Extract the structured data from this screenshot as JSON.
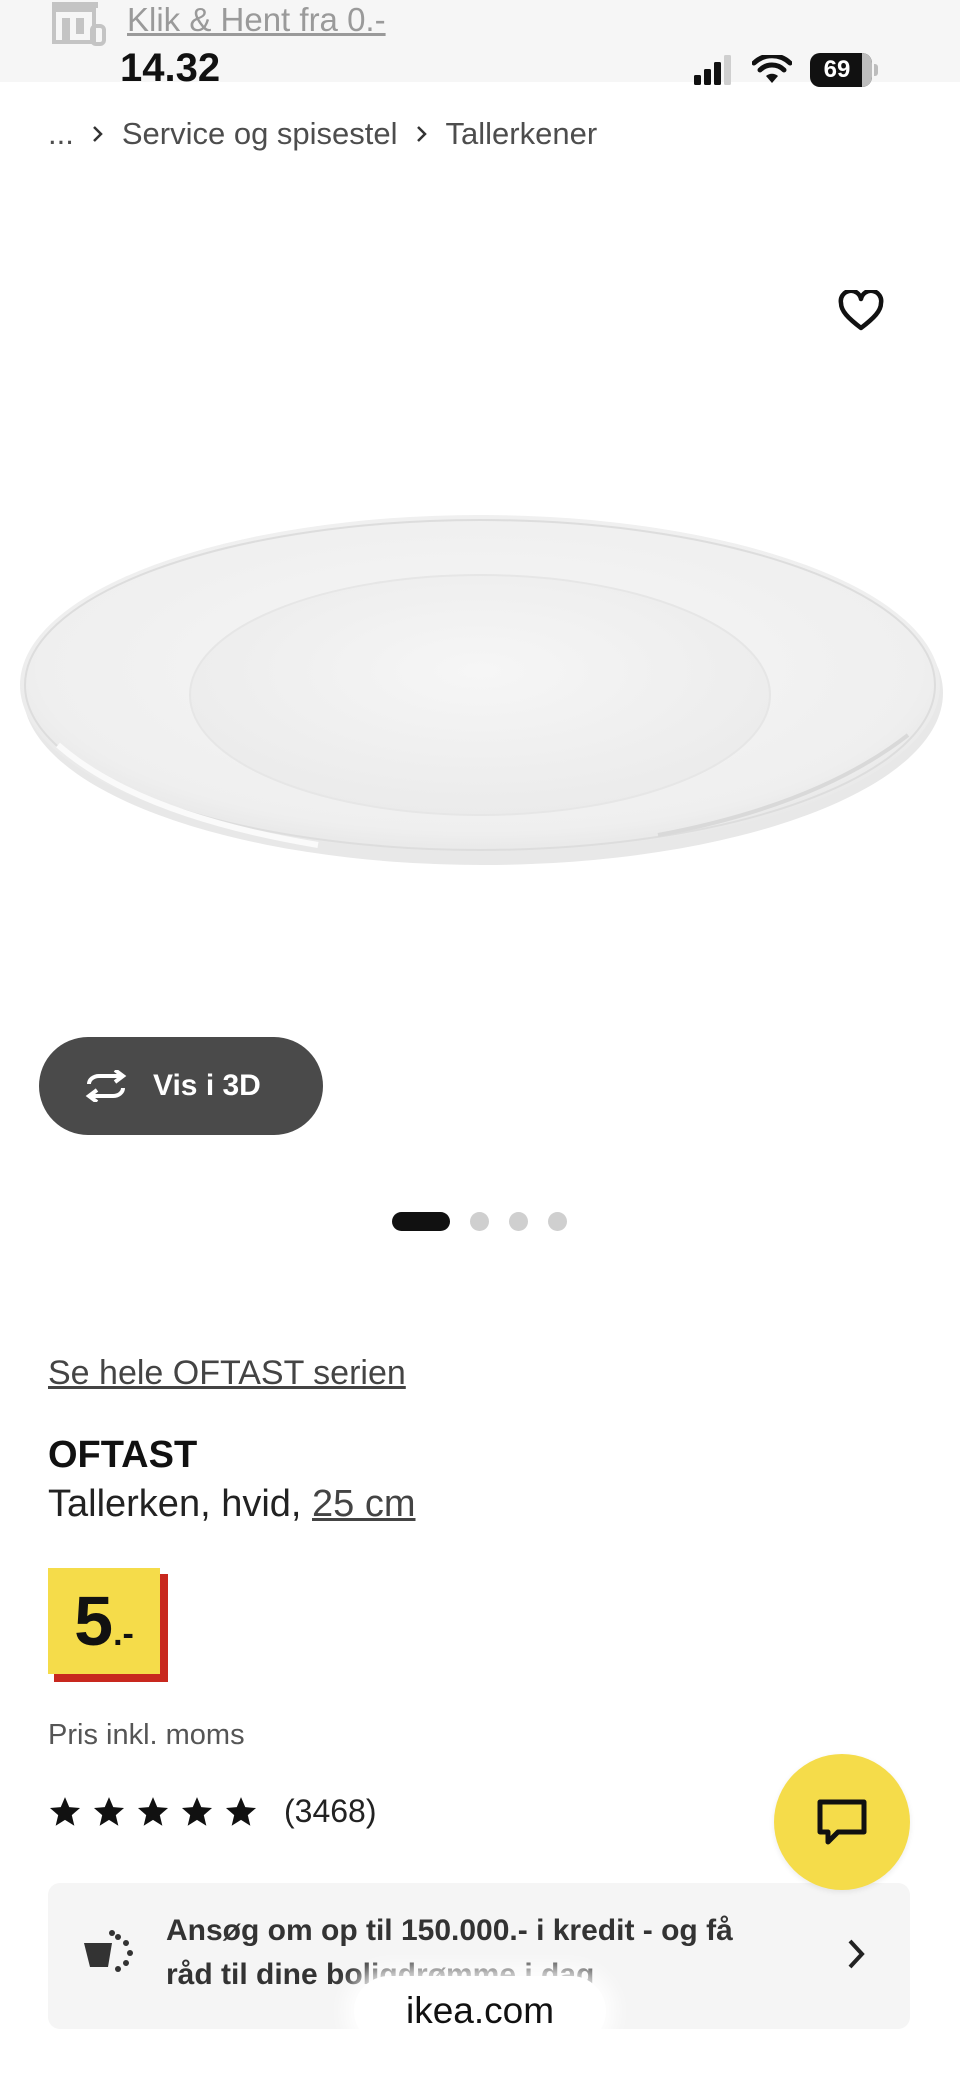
{
  "banner": {
    "link_text": "Klik & Hent fra 0.-",
    "icon": "store-icon"
  },
  "status_bar": {
    "time": "14.32",
    "battery": "69"
  },
  "breadcrumb": {
    "ellipsis": "...",
    "items": [
      "Service og spisestel",
      "Tallerkener"
    ]
  },
  "product": {
    "series_link": "Se hele OFTAST serien",
    "name": "OFTAST",
    "description": "Tallerken, hvid, ",
    "size": "25 cm",
    "price_main": "5",
    "price_suffix": ".-",
    "price_note": "Pris inkl. moms",
    "rating": 5,
    "review_count": "(3468)"
  },
  "gallery": {
    "view_3d_label": "Vis i 3D",
    "dots": 4,
    "active_dot": 0
  },
  "credit": {
    "text": "Ansøg om op til 150.000.- i kredit - og få råd til dine boligdrømme i dag"
  },
  "browser": {
    "url": "ikea.com"
  },
  "colors": {
    "ikea_yellow": "#f5dc4a",
    "price_red": "#c8281e",
    "button_dark": "#4a4a4a"
  }
}
